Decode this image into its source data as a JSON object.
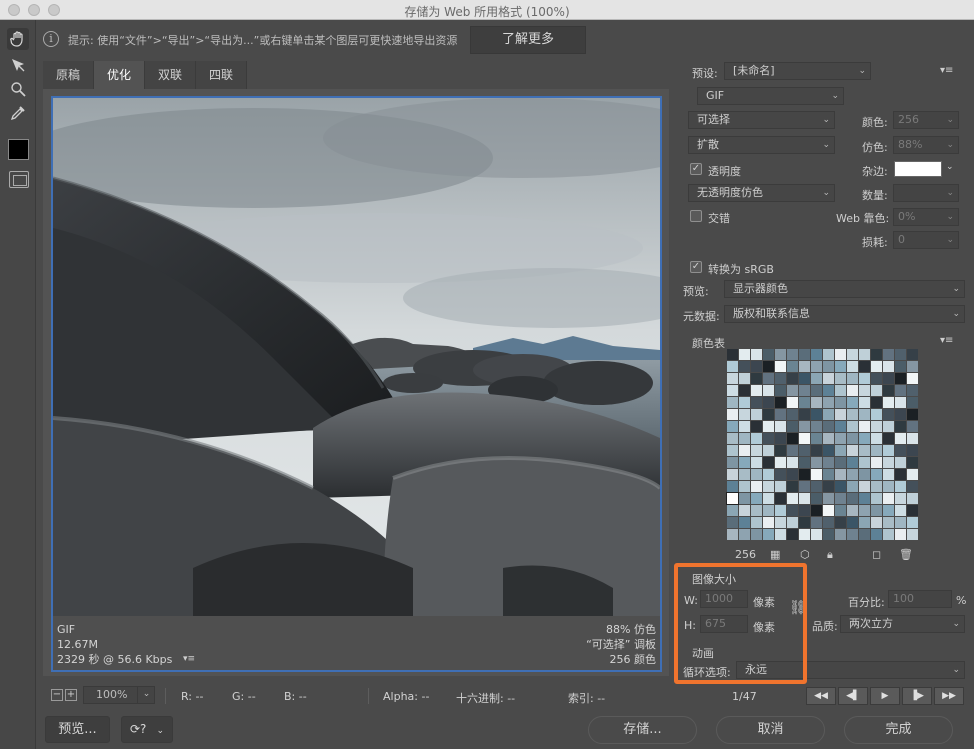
{
  "window": {
    "title": "存储为 Web 所用格式 (100%)"
  },
  "hint": {
    "text": "提示: 使用“文件”>“导出”>“导出为...”或右键单击某个图层可更快速地导出资源",
    "learn_more": "了解更多"
  },
  "tabs": [
    "原稿",
    "优化",
    "双联",
    "四联"
  ],
  "image_info": {
    "format": "GIF",
    "size": "12.67M",
    "time": "2329 秒 @ 56.6 Kbps",
    "dither": "88% 仿色",
    "palette": "“可选择” 调板",
    "colors": "256 颜色"
  },
  "status": {
    "zoom": "100%",
    "r": "R: --",
    "g": "G: --",
    "b": "B: --",
    "alpha": "Alpha: --",
    "hex": "十六进制: --",
    "index": "索引: --"
  },
  "buttons": {
    "preview": "预览...",
    "save": "存储...",
    "cancel": "取消",
    "done": "完成"
  },
  "settings": {
    "preset_label": "预设:",
    "preset_value": "[未命名]",
    "format": "GIF",
    "reduction": "可选择",
    "colors_label": "颜色:",
    "colors_value": "256",
    "dither_algo": "扩散",
    "dither_label": "仿色:",
    "dither_value": "88%",
    "transparency_label": "透明度",
    "matte_label": "杂边:",
    "trans_dither": "无透明度仿色",
    "amount_label": "数量:",
    "interlaced_label": "交错",
    "websnap_label": "Web 靠色:",
    "websnap_value": "0%",
    "lossy_label": "损耗:",
    "lossy_value": "0",
    "srgb_label": "转换为 sRGB",
    "preview_label": "预览:",
    "preview_value": "显示器颜色",
    "metadata_label": "元数据:",
    "metadata_value": "版权和联系信息",
    "color_table_label": "颜色表",
    "color_count": "256"
  },
  "image_size": {
    "title": "图像大小",
    "w_label": "W:",
    "w_value": "1000",
    "h_label": "H:",
    "h_value": "675",
    "unit": "像素",
    "percent_label": "百分比:",
    "percent_value": "100",
    "percent_unit": "%",
    "quality_label": "品质:",
    "quality_value": "两次立方"
  },
  "animation": {
    "title": "动画",
    "loop_label": "循环选项:",
    "loop_value": "永远",
    "frame": "1/47"
  },
  "colors": {
    "highlight": "#f0742e",
    "selection_border": "#3f6fb5"
  },
  "palette_colors": [
    "#2a3036",
    "#3c4650",
    "#50606c",
    "#6f8290",
    "#8ea3b0",
    "#a8bcc6",
    "#c7d6dd",
    "#e3ecef",
    "#1b2024",
    "#364048",
    "#5a6d7a",
    "#7e95a3",
    "#9fb6c2",
    "#bfd0d8",
    "#d9e4e9",
    "#f2f6f7",
    "#3b5566",
    "#5d8196",
    "#86a9bb",
    "#b0cbd7",
    "#2f3a40",
    "#4b5d68",
    "#6a8492",
    "#8ba6b4",
    "#aec4ce",
    "#cdddE4",
    "#44505a",
    "#627280",
    "#8596a2",
    "#a7b6c0",
    "#c8d3da",
    "#e9eef1"
  ]
}
